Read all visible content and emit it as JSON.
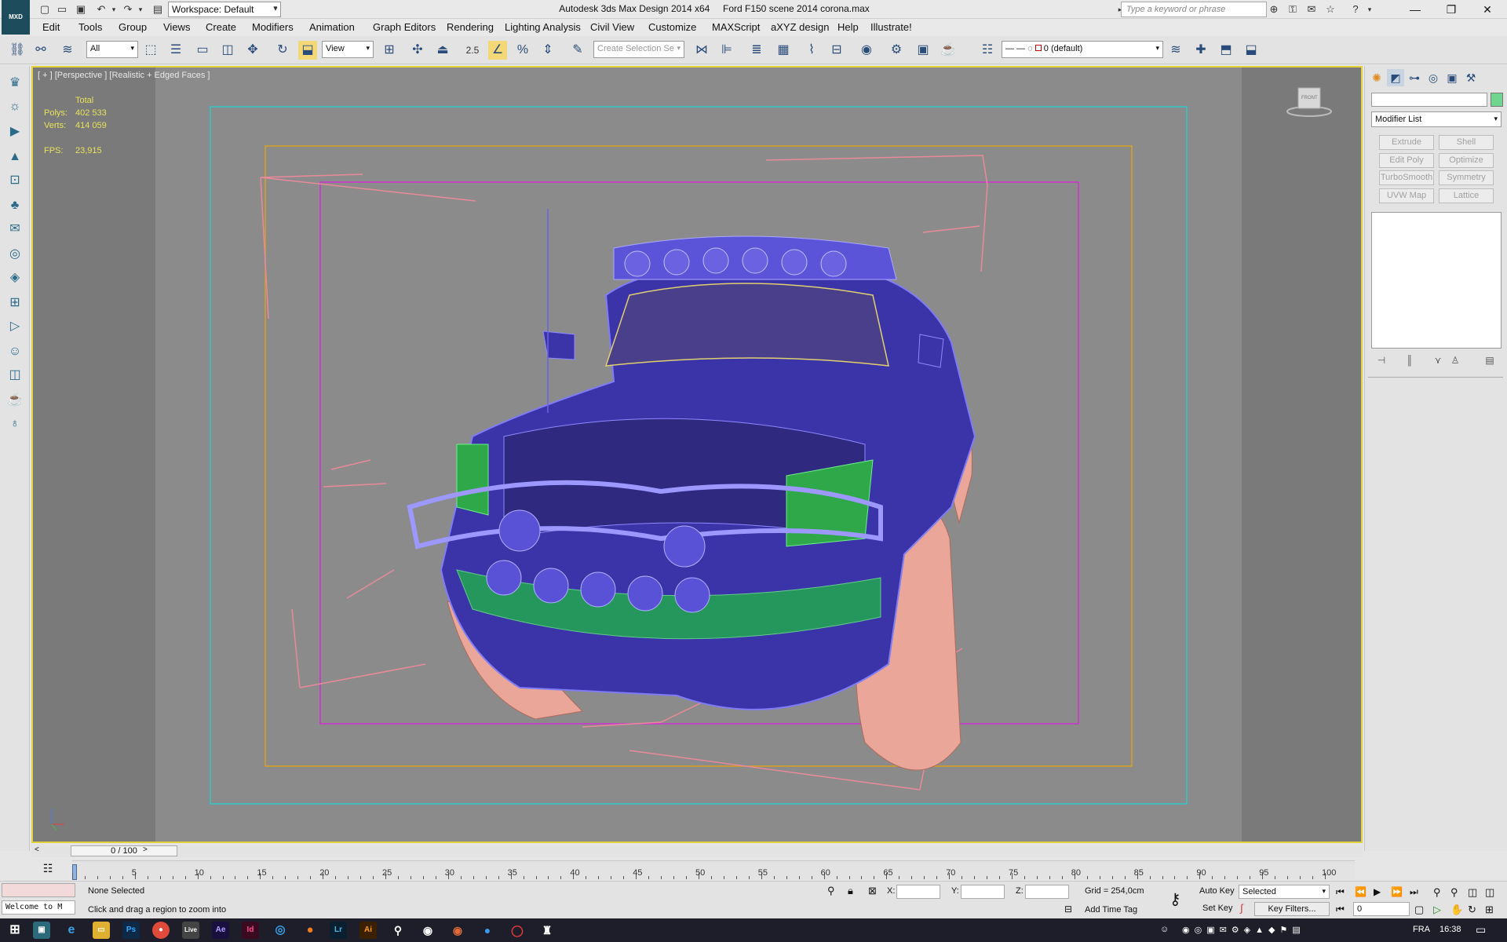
{
  "titlebar": {
    "logo": "MXD",
    "workspace": "Workspace: Default",
    "title": "Autodesk 3ds Max Design 2014 x64",
    "file": "Ford F150 scene 2014 corona.max",
    "search_placeholder": "Type a keyword or phrase"
  },
  "menu": [
    "Edit",
    "Tools",
    "Group",
    "Views",
    "Create",
    "Modifiers",
    "Animation",
    "Graph Editors",
    "Rendering",
    "Lighting Analysis",
    "Civil View",
    "Customize",
    "MAXScript",
    "aXYZ design",
    "Help",
    "Illustrate!"
  ],
  "toolbar": {
    "filter": "All",
    "refcoord": "View",
    "snap_label": "2.5",
    "selection_set": "Create Selection Se",
    "layer": "0 (default)"
  },
  "viewport": {
    "label": "[ + ] [Perspective ] [Realistic + Edged Faces ]",
    "total_label": "Total",
    "polys_label": "Polys:",
    "polys": "402 533",
    "verts_label": "Verts:",
    "verts": "414 059",
    "fps_label": "FPS:",
    "fps": "23,915",
    "viewcube_face": "FRONT"
  },
  "panel": {
    "modifier_list": "Modifier List",
    "buttons": [
      "Extrude",
      "Shell",
      "Edit Poly",
      "Optimize",
      "TurboSmooth",
      "Symmetry",
      "UVW Map",
      "Lattice"
    ]
  },
  "timeline": {
    "frame": "0 / 100",
    "ticks": [
      "5",
      "10",
      "15",
      "20",
      "25",
      "30",
      "35",
      "40",
      "45",
      "50",
      "55",
      "60",
      "65",
      "70",
      "75",
      "80",
      "85",
      "90",
      "95",
      "100"
    ]
  },
  "status": {
    "selection": "None Selected",
    "prompt": "Click and drag a region to zoom into",
    "listener": "Welcome to M",
    "x_label": "X:",
    "y_label": "Y:",
    "z_label": "Z:",
    "grid": "Grid = 254,0cm",
    "add_time_tag": "Add Time Tag",
    "auto_key": "Auto Key",
    "set_key": "Set Key",
    "selected": "Selected",
    "key_filters": "Key Filters...",
    "frame_field": "0"
  },
  "taskbar": {
    "apps": [
      "Ps",
      "Lr",
      "Ae",
      "Id",
      "Ai"
    ],
    "lang": "FRA",
    "time": "16:38"
  }
}
